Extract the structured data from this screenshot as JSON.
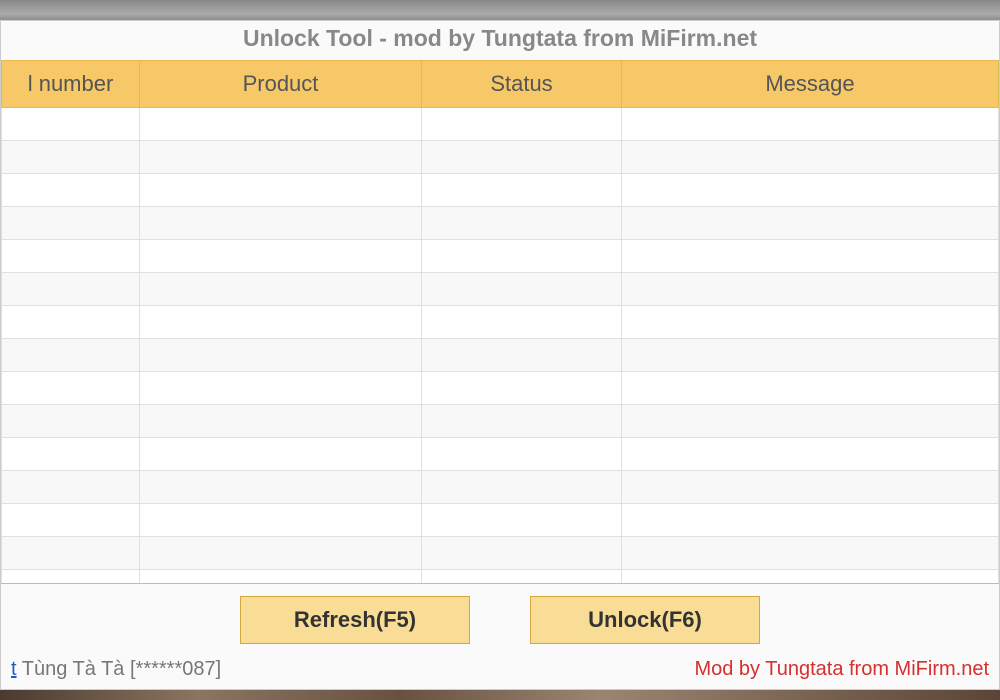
{
  "window": {
    "title": "Unlock Tool - mod by Tungtata from MiFirm.net"
  },
  "table": {
    "headers": [
      "l number",
      "Product",
      "Status",
      "Message"
    ],
    "row_count": 15
  },
  "buttons": {
    "refresh": "Refresh(F5)",
    "unlock": "Unlock(F6)"
  },
  "footer": {
    "user_link_partial": "t",
    "user_name": "Tùng Tà Tà [******087]",
    "mod_credit": "Mod by Tungtata from MiFirm.net"
  }
}
